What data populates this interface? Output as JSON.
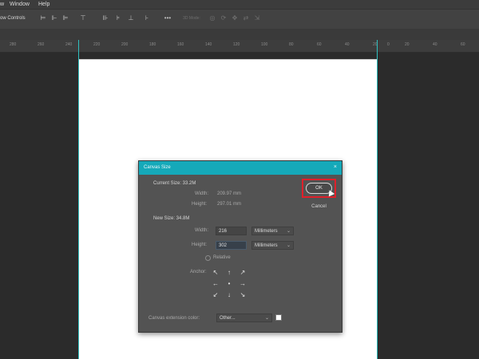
{
  "menu": {
    "items": [
      "w",
      "Window",
      "Help"
    ]
  },
  "options_bar": {
    "show_controls_label": "ow Controls",
    "more_label": "•••",
    "mode_label": "3D Mode:"
  },
  "ruler": {
    "labels": [
      "280",
      "260",
      "240",
      "220",
      "200",
      "180",
      "160",
      "140",
      "120",
      "100",
      "80",
      "60",
      "40",
      "20",
      "0",
      "20",
      "40",
      "60"
    ]
  },
  "dialog": {
    "title": "Canvas Size",
    "close_label": "×",
    "current_size_label": "Current Size: 33.2M",
    "current_width_label": "Width:",
    "current_width_value": "209.97 mm",
    "current_height_label": "Height:",
    "current_height_value": "297.01 mm",
    "new_size_label": "New Size: 34.8M",
    "width_label": "Width:",
    "width_value": "216",
    "width_unit": "Millimeters",
    "height_label": "Height:",
    "height_value": "302",
    "height_unit": "Millimeters",
    "relative_label": "Relative",
    "anchor_label": "Anchor:",
    "anchor_arrows": [
      "↖",
      "↑",
      "↗",
      "←",
      "•",
      "→",
      "↙",
      "↓",
      "↘"
    ],
    "ext_color_label": "Canvas extension color:",
    "ext_color_value": "Other...",
    "ext_color_swatch": "#ffffff",
    "ok_label": "OK",
    "cancel_label": "Cancel"
  },
  "colors": {
    "titlebar": "#15a9b9",
    "highlight": "#e0202a",
    "guide": "#2fbfbf"
  }
}
